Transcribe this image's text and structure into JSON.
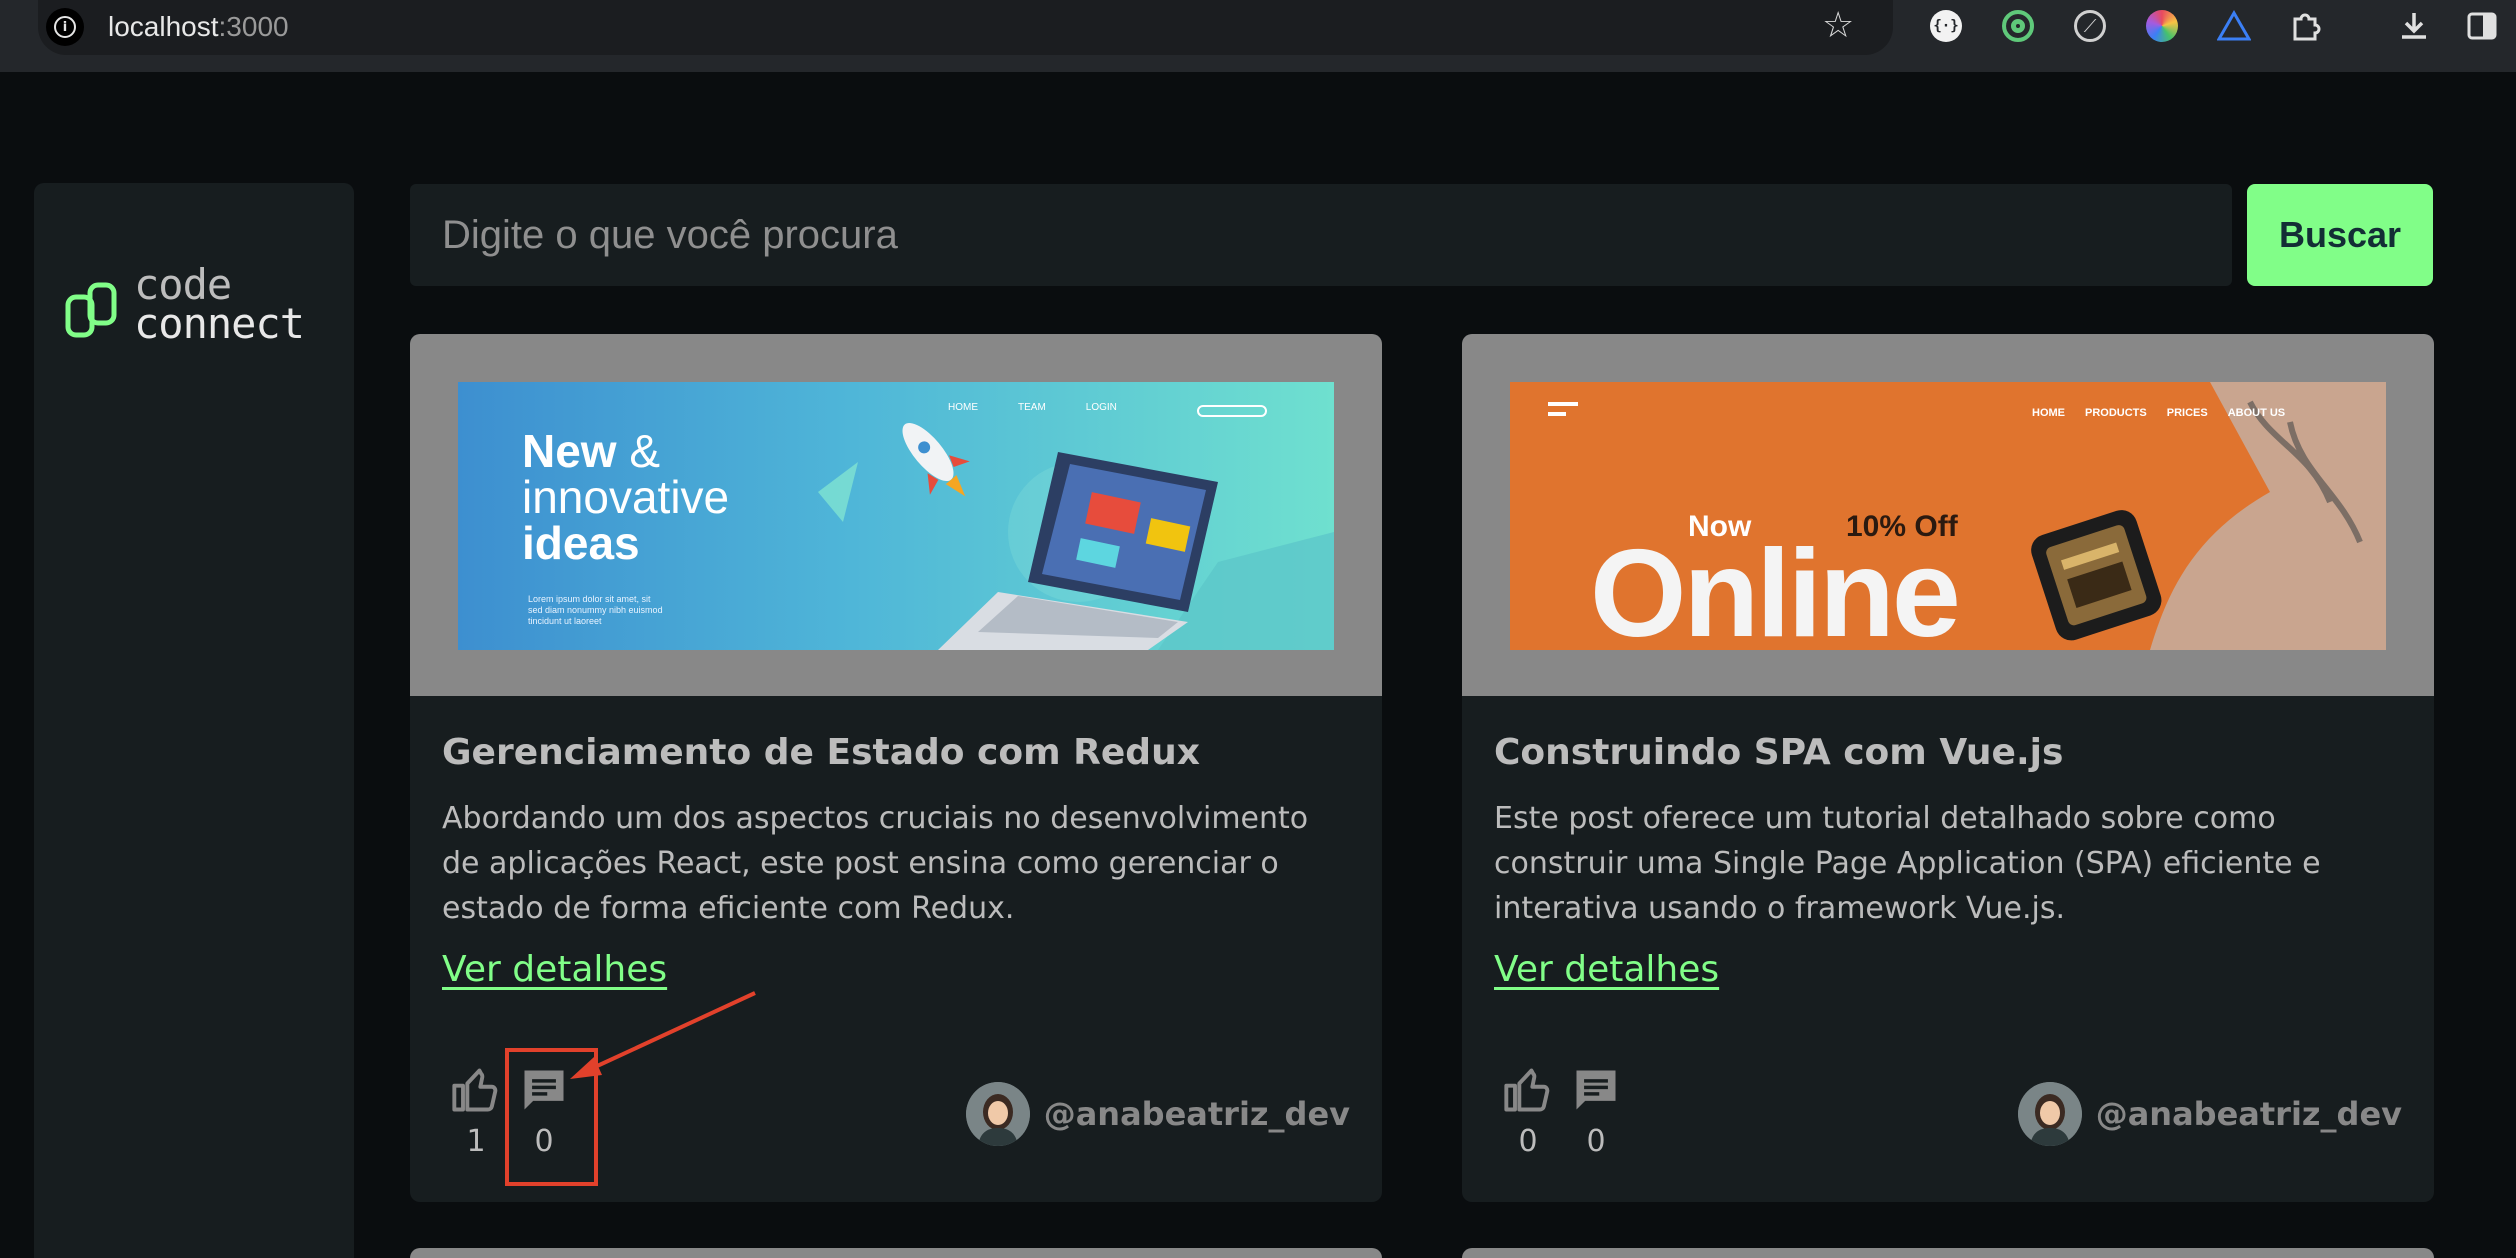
{
  "browser": {
    "url_host": "localhost",
    "url_port": ":3000"
  },
  "sidebar": {
    "logo_word1": "code",
    "logo_word2": "connect"
  },
  "search": {
    "placeholder": "Digite o que você procura",
    "button_label": "Buscar"
  },
  "posts": [
    {
      "banner": {
        "nav": [
          "HOME",
          "TEAM",
          "LOGIN"
        ],
        "headline_1": "New",
        "headline_amp": "&",
        "headline_2": "innovative",
        "headline_3": "ideas",
        "lorem": [
          "Lorem ipsum dolor sit amet, sit",
          "sed diam nonummy nibh euismod",
          "tincidunt ut laoreet"
        ]
      },
      "title": "Gerenciamento de Estado com Redux",
      "description": "Abordando um dos aspectos cruciais no desenvolvimento de aplicações React, este post ensina como gerenciar o estado de forma eficiente com Redux.",
      "link": "Ver detalhes",
      "likes": "1",
      "comments": "0",
      "author": "@anabeatriz_dev"
    },
    {
      "banner": {
        "nav": [
          "HOME",
          "PRODUCTS",
          "PRICES",
          "ABOUT US"
        ],
        "now": "Now",
        "offer": "10% Off",
        "headline": "Online"
      },
      "title": "Construindo SPA com Vue.js",
      "description": "Este post oferece um tutorial detalhado sobre como construir uma Single Page Application (SPA) eficiente e interativa usando o framework Vue.js.",
      "link": "Ver detalhes",
      "likes": "0",
      "comments": "0",
      "author": "@anabeatriz_dev"
    }
  ],
  "icons": {
    "info": "info-icon",
    "star": "star-icon",
    "like": "thumbs-up-icon",
    "comment": "comment-icon"
  },
  "colors": {
    "accent": "#81fe88",
    "background": "#0a0d0f",
    "surface": "#171d1f",
    "annotation": "#e2412b"
  }
}
